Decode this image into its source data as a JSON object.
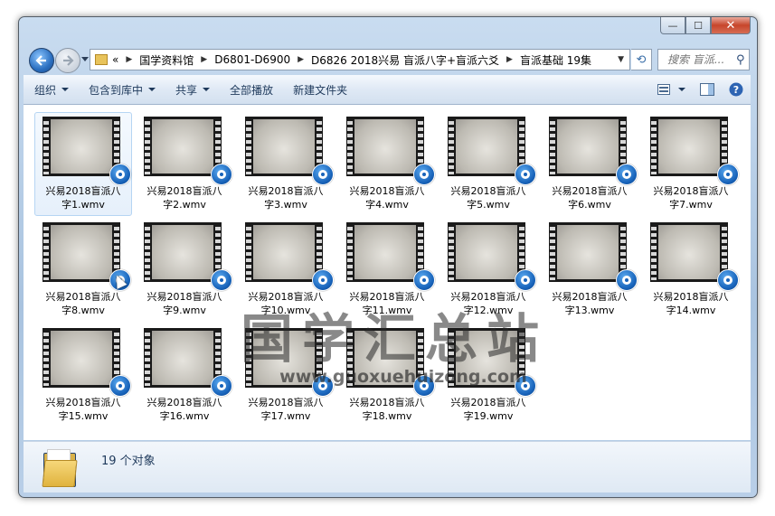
{
  "window": {
    "controls": {
      "minimize": "—",
      "maximize": "☐",
      "close": "✕"
    }
  },
  "nav": {
    "back_icon": "back-arrow-icon",
    "forward_icon": "forward-arrow-icon"
  },
  "address": {
    "prefix": "«",
    "crumbs": [
      "国学资料馆",
      "D6801-D6900",
      "D6826 2018兴易 盲派八字+盲派六爻",
      "盲派基础 19集"
    ]
  },
  "search": {
    "placeholder": "搜索 盲派..."
  },
  "toolbar": {
    "organize": "组织",
    "include_in_library": "包含到库中",
    "share": "共享",
    "play_all": "全部播放",
    "new_folder": "新建文件夹"
  },
  "files": [
    {
      "line1": "兴易2018盲派八",
      "line2": "字1.wmv"
    },
    {
      "line1": "兴易2018盲派八",
      "line2": "字2.wmv"
    },
    {
      "line1": "兴易2018盲派八",
      "line2": "字3.wmv"
    },
    {
      "line1": "兴易2018盲派八",
      "line2": "字4.wmv"
    },
    {
      "line1": "兴易2018盲派八",
      "line2": "字5.wmv"
    },
    {
      "line1": "兴易2018盲派八",
      "line2": "字6.wmv"
    },
    {
      "line1": "兴易2018盲派八",
      "line2": "字7.wmv"
    },
    {
      "line1": "兴易2018盲派八",
      "line2": "字8.wmv"
    },
    {
      "line1": "兴易2018盲派八",
      "line2": "字9.wmv"
    },
    {
      "line1": "兴易2018盲派八",
      "line2": "字10.wmv"
    },
    {
      "line1": "兴易2018盲派八",
      "line2": "字11.wmv"
    },
    {
      "line1": "兴易2018盲派八",
      "line2": "字12.wmv"
    },
    {
      "line1": "兴易2018盲派八",
      "line2": "字13.wmv"
    },
    {
      "line1": "兴易2018盲派八",
      "line2": "字14.wmv"
    },
    {
      "line1": "兴易2018盲派八",
      "line2": "字15.wmv"
    },
    {
      "line1": "兴易2018盲派八",
      "line2": "字16.wmv"
    },
    {
      "line1": "兴易2018盲派八",
      "line2": "字17.wmv"
    },
    {
      "line1": "兴易2018盲派八",
      "line2": "字18.wmv"
    },
    {
      "line1": "兴易2018盲派八",
      "line2": "字19.wmv"
    }
  ],
  "watermark": {
    "text": "国学汇总站",
    "url": "www.guoxuehuizong.com"
  },
  "details": {
    "count": "19 个对象"
  }
}
